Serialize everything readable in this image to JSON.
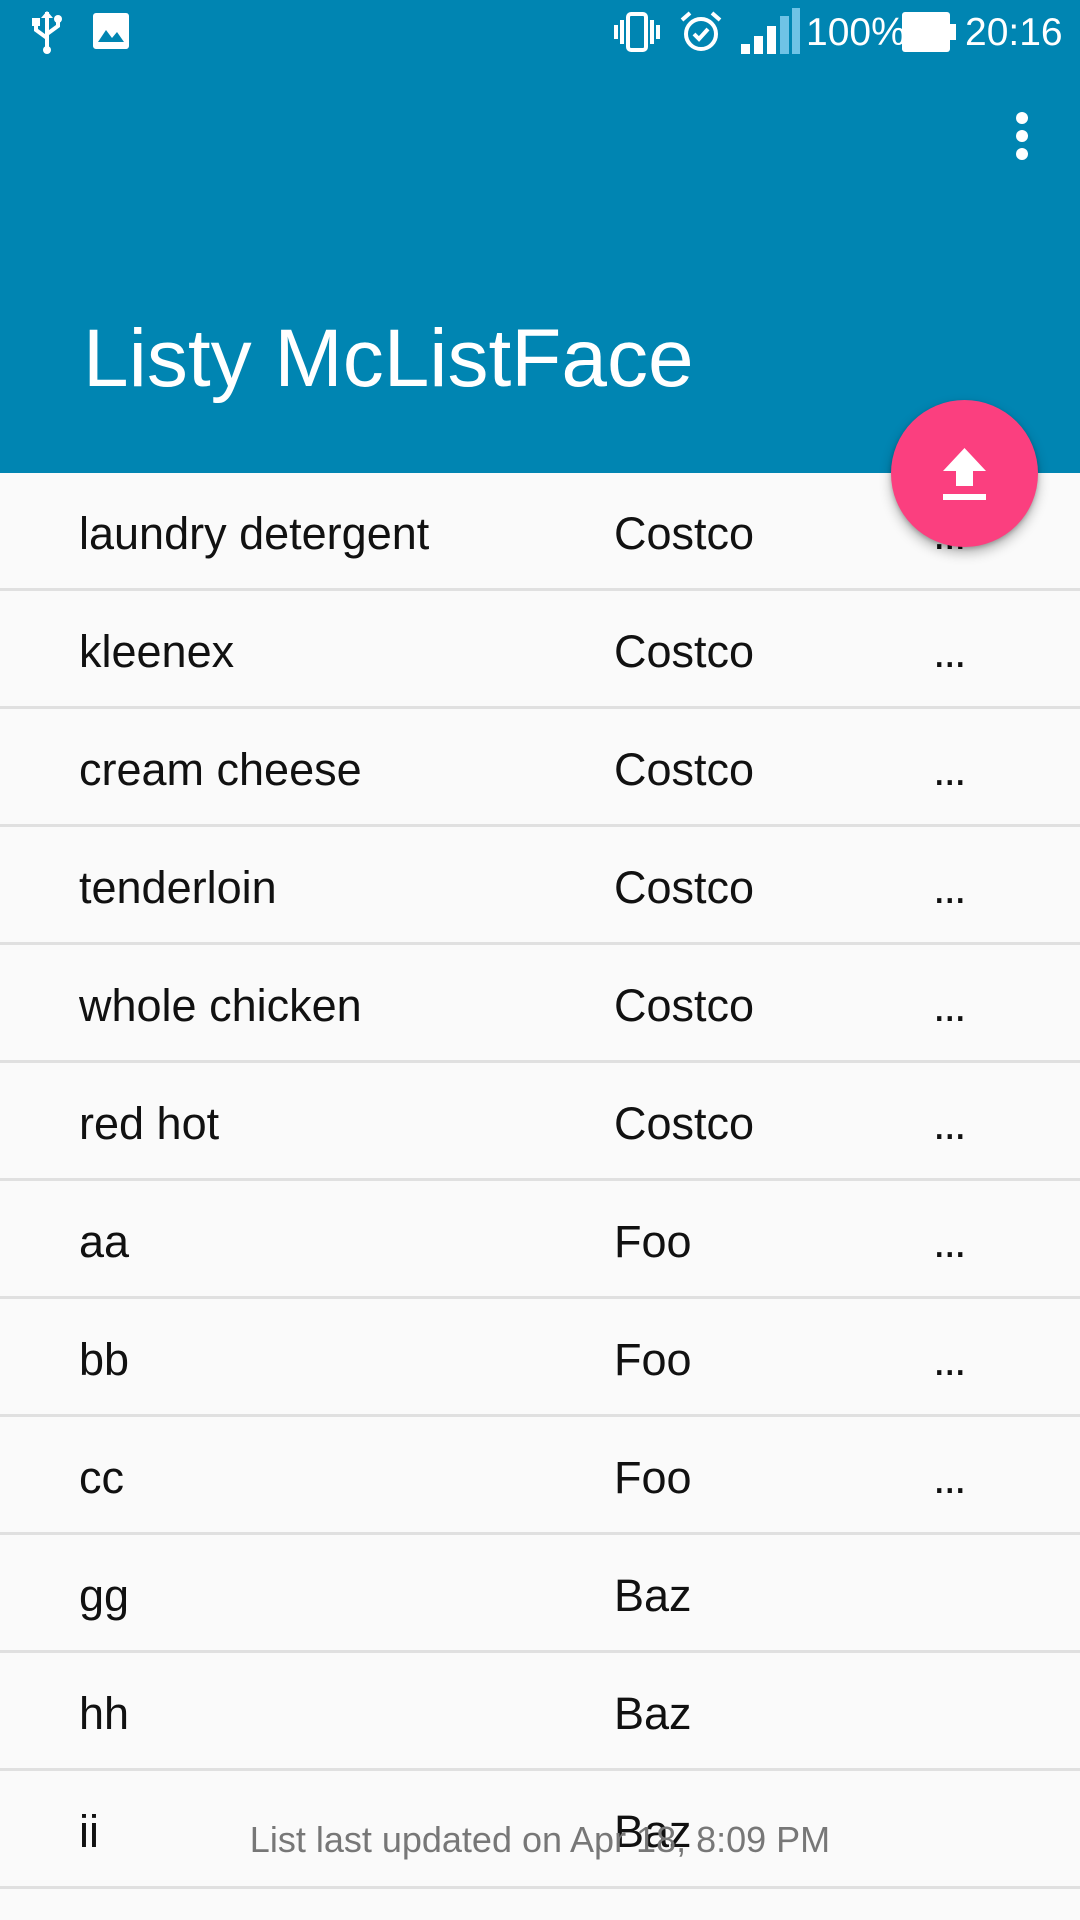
{
  "status_bar": {
    "icons_left": [
      "usb-icon",
      "image-icon"
    ],
    "icons_right": [
      "vibrate-icon",
      "alarm-icon",
      "signal-icon",
      "battery-icon"
    ],
    "battery": "100%",
    "time": "20:16"
  },
  "app_bar": {
    "title": "Listy McListFace",
    "menu_icon": "more-vert-icon",
    "color": "#0085b2"
  },
  "fab": {
    "icon": "upload-icon",
    "color": "#fb3f7f"
  },
  "list": {
    "rows": [
      {
        "name": "laundry detergent",
        "store": "Costco",
        "more": "..."
      },
      {
        "name": "kleenex",
        "store": "Costco",
        "more": "..."
      },
      {
        "name": "cream cheese",
        "store": "Costco",
        "more": "..."
      },
      {
        "name": "tenderloin",
        "store": "Costco",
        "more": "..."
      },
      {
        "name": "whole chicken",
        "store": "Costco",
        "more": "..."
      },
      {
        "name": "red hot",
        "store": "Costco",
        "more": "..."
      },
      {
        "name": "aa",
        "store": "Foo",
        "more": "..."
      },
      {
        "name": "bb",
        "store": "Foo",
        "more": "..."
      },
      {
        "name": "cc",
        "store": "Foo",
        "more": "..."
      },
      {
        "name": "gg",
        "store": "Baz",
        "more": ""
      },
      {
        "name": "hh",
        "store": "Baz",
        "more": ""
      },
      {
        "name": "ii",
        "store": "Baz",
        "more": ""
      }
    ]
  },
  "footer": {
    "text": "List last updated on Apr 18, 8:09 PM"
  }
}
